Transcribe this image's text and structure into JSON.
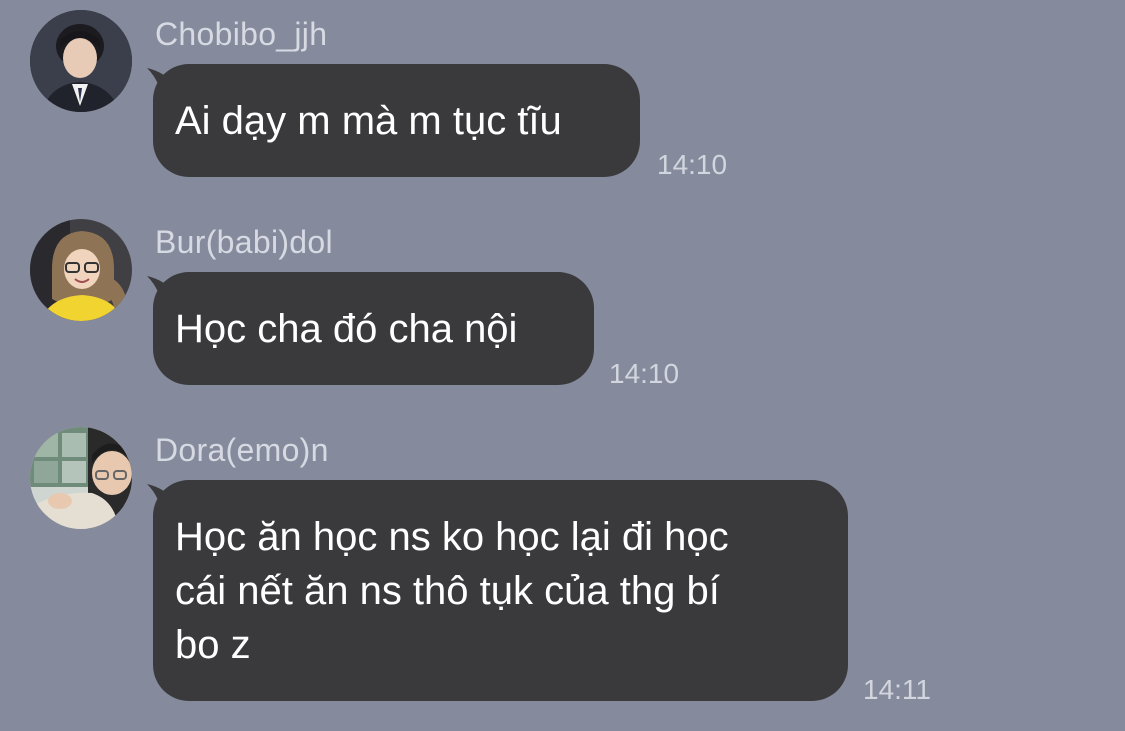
{
  "messages": [
    {
      "sender": "Chobibo_jjh",
      "text": "Ai dạy m mà m tục tĩu",
      "time": "14:10",
      "avatar_icon": "person-photo-icon"
    },
    {
      "sender": "Bur(babi)dol",
      "text": "Học cha đó cha nội",
      "time": "14:10",
      "avatar_icon": "person-photo-icon"
    },
    {
      "sender": "Dora(emo)n",
      "text": "Học ăn học ns ko học lại đi học\ncái nết ăn ns thô tụk của thg bí\nbo z",
      "time": "14:11",
      "avatar_icon": "person-photo-icon"
    }
  ],
  "colors": {
    "background": "#858b9c",
    "bubble": "#3a3a3d",
    "bubble_text": "#ffffff",
    "meta_text": "#d7dae3"
  }
}
